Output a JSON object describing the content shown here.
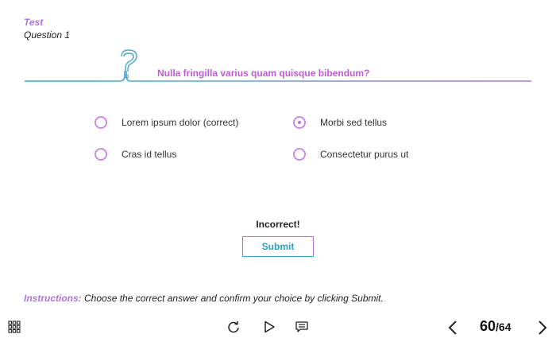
{
  "header": {
    "test_title": "Test",
    "question_number": "Question 1"
  },
  "question": {
    "text": "Nulla fringilla varius quam quisque bibendum?",
    "options": [
      {
        "label": "Lorem ipsum dolor (correct)",
        "selected": false
      },
      {
        "label": "Morbi sed tellus",
        "selected": true
      },
      {
        "label": "Cras id tellus",
        "selected": false
      },
      {
        "label": "Consectetur purus ut",
        "selected": false
      }
    ]
  },
  "feedback": "Incorrect!",
  "submit_label": "Submit",
  "instructions": {
    "label": "Instructions:",
    "text": "Choose the correct answer and confirm your choice by clicking Submit."
  },
  "toolbar": {
    "icons": [
      "menu-grid-icon",
      "replay-icon",
      "play-icon",
      "transcript-icon",
      "previous-icon",
      "next-icon"
    ],
    "current_page": "60",
    "total_pages": "/64"
  },
  "colors": {
    "accent_purple": "#b073d6",
    "question_pink": "#c05ad6",
    "accent_blue": "#3aa5c8"
  }
}
